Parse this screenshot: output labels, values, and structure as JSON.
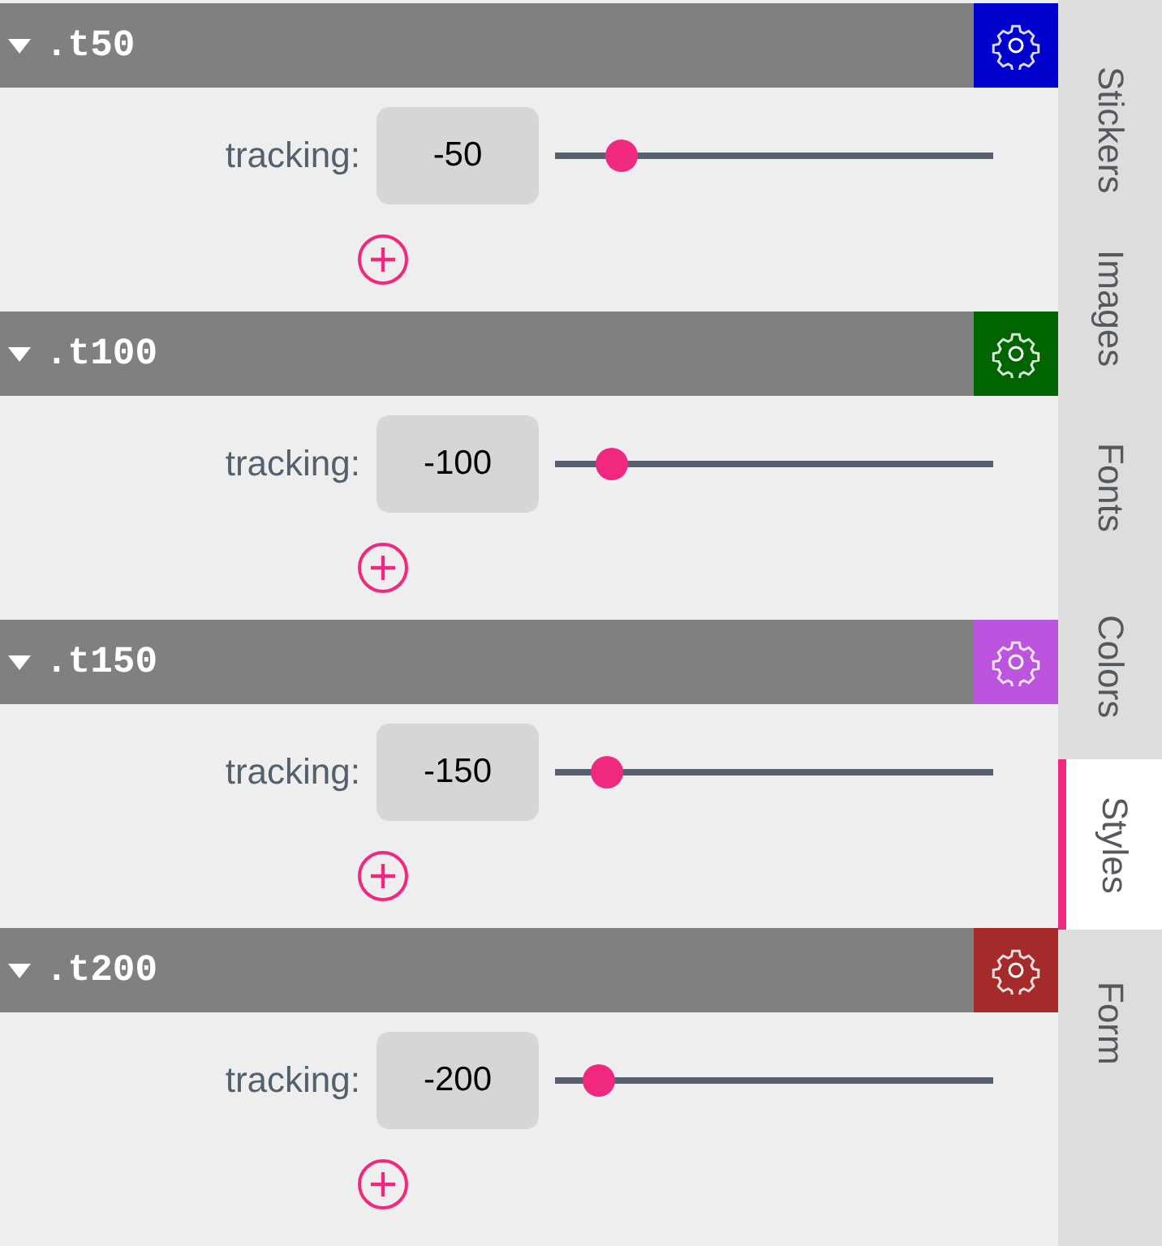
{
  "styles": [
    {
      "name": ".t50",
      "expanded": true,
      "color": "#0000cc",
      "label": "tracking:",
      "value": "-50",
      "level": 0.15
    },
    {
      "name": ".t100",
      "expanded": true,
      "color": "#006400",
      "label": "tracking:",
      "value": "-100",
      "level": 0.13
    },
    {
      "name": ".t150",
      "expanded": true,
      "color": "#bb55dd",
      "label": "tracking:",
      "value": "-150",
      "level": 0.12
    },
    {
      "name": ".t200",
      "expanded": true,
      "color": "#a52a2a",
      "label": "tracking:",
      "value": "-200",
      "level": 0.1
    }
  ],
  "tabs": [
    {
      "label": "Stickers",
      "selected": false
    },
    {
      "label": "Images",
      "selected": false
    },
    {
      "label": "Fonts",
      "selected": false
    },
    {
      "label": "Colors",
      "selected": false
    },
    {
      "label": "Styles",
      "selected": true
    },
    {
      "label": "Form",
      "selected": false
    }
  ]
}
